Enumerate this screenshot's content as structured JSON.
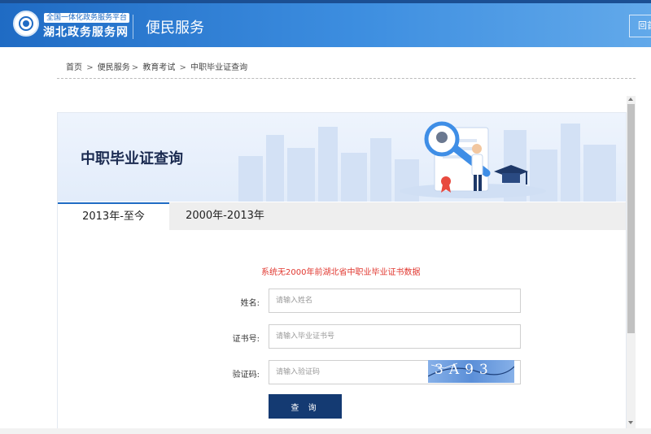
{
  "header": {
    "platform_tag": "全国一体化政务服务平台",
    "site_name": "湖北政务服务网",
    "section_title": "便民服务",
    "home_button": "回首页"
  },
  "breadcrumb": {
    "items": [
      "首页",
      "便民服务",
      "教育考试",
      "中职毕业证查询"
    ],
    "separator": ">"
  },
  "banner": {
    "title": "中职毕业证查询"
  },
  "tabs": [
    {
      "label": "2013年-至今",
      "active": true
    },
    {
      "label": "2000年-2013年",
      "active": false
    }
  ],
  "form": {
    "notice": "系统无2000年前湖北省中职业毕业证书数据",
    "name_label": "姓名:",
    "name_placeholder": "请输入姓名",
    "cert_label": "证书号:",
    "cert_placeholder": "请输入毕业证书号",
    "captcha_label": "验证码:",
    "captcha_placeholder": "请输入验证码",
    "captcha_text": "3A93",
    "submit_label": "查 询"
  },
  "colors": {
    "header_blue": "#1f6bc4",
    "notice_red": "#e1372f",
    "button_navy": "#143a72"
  }
}
